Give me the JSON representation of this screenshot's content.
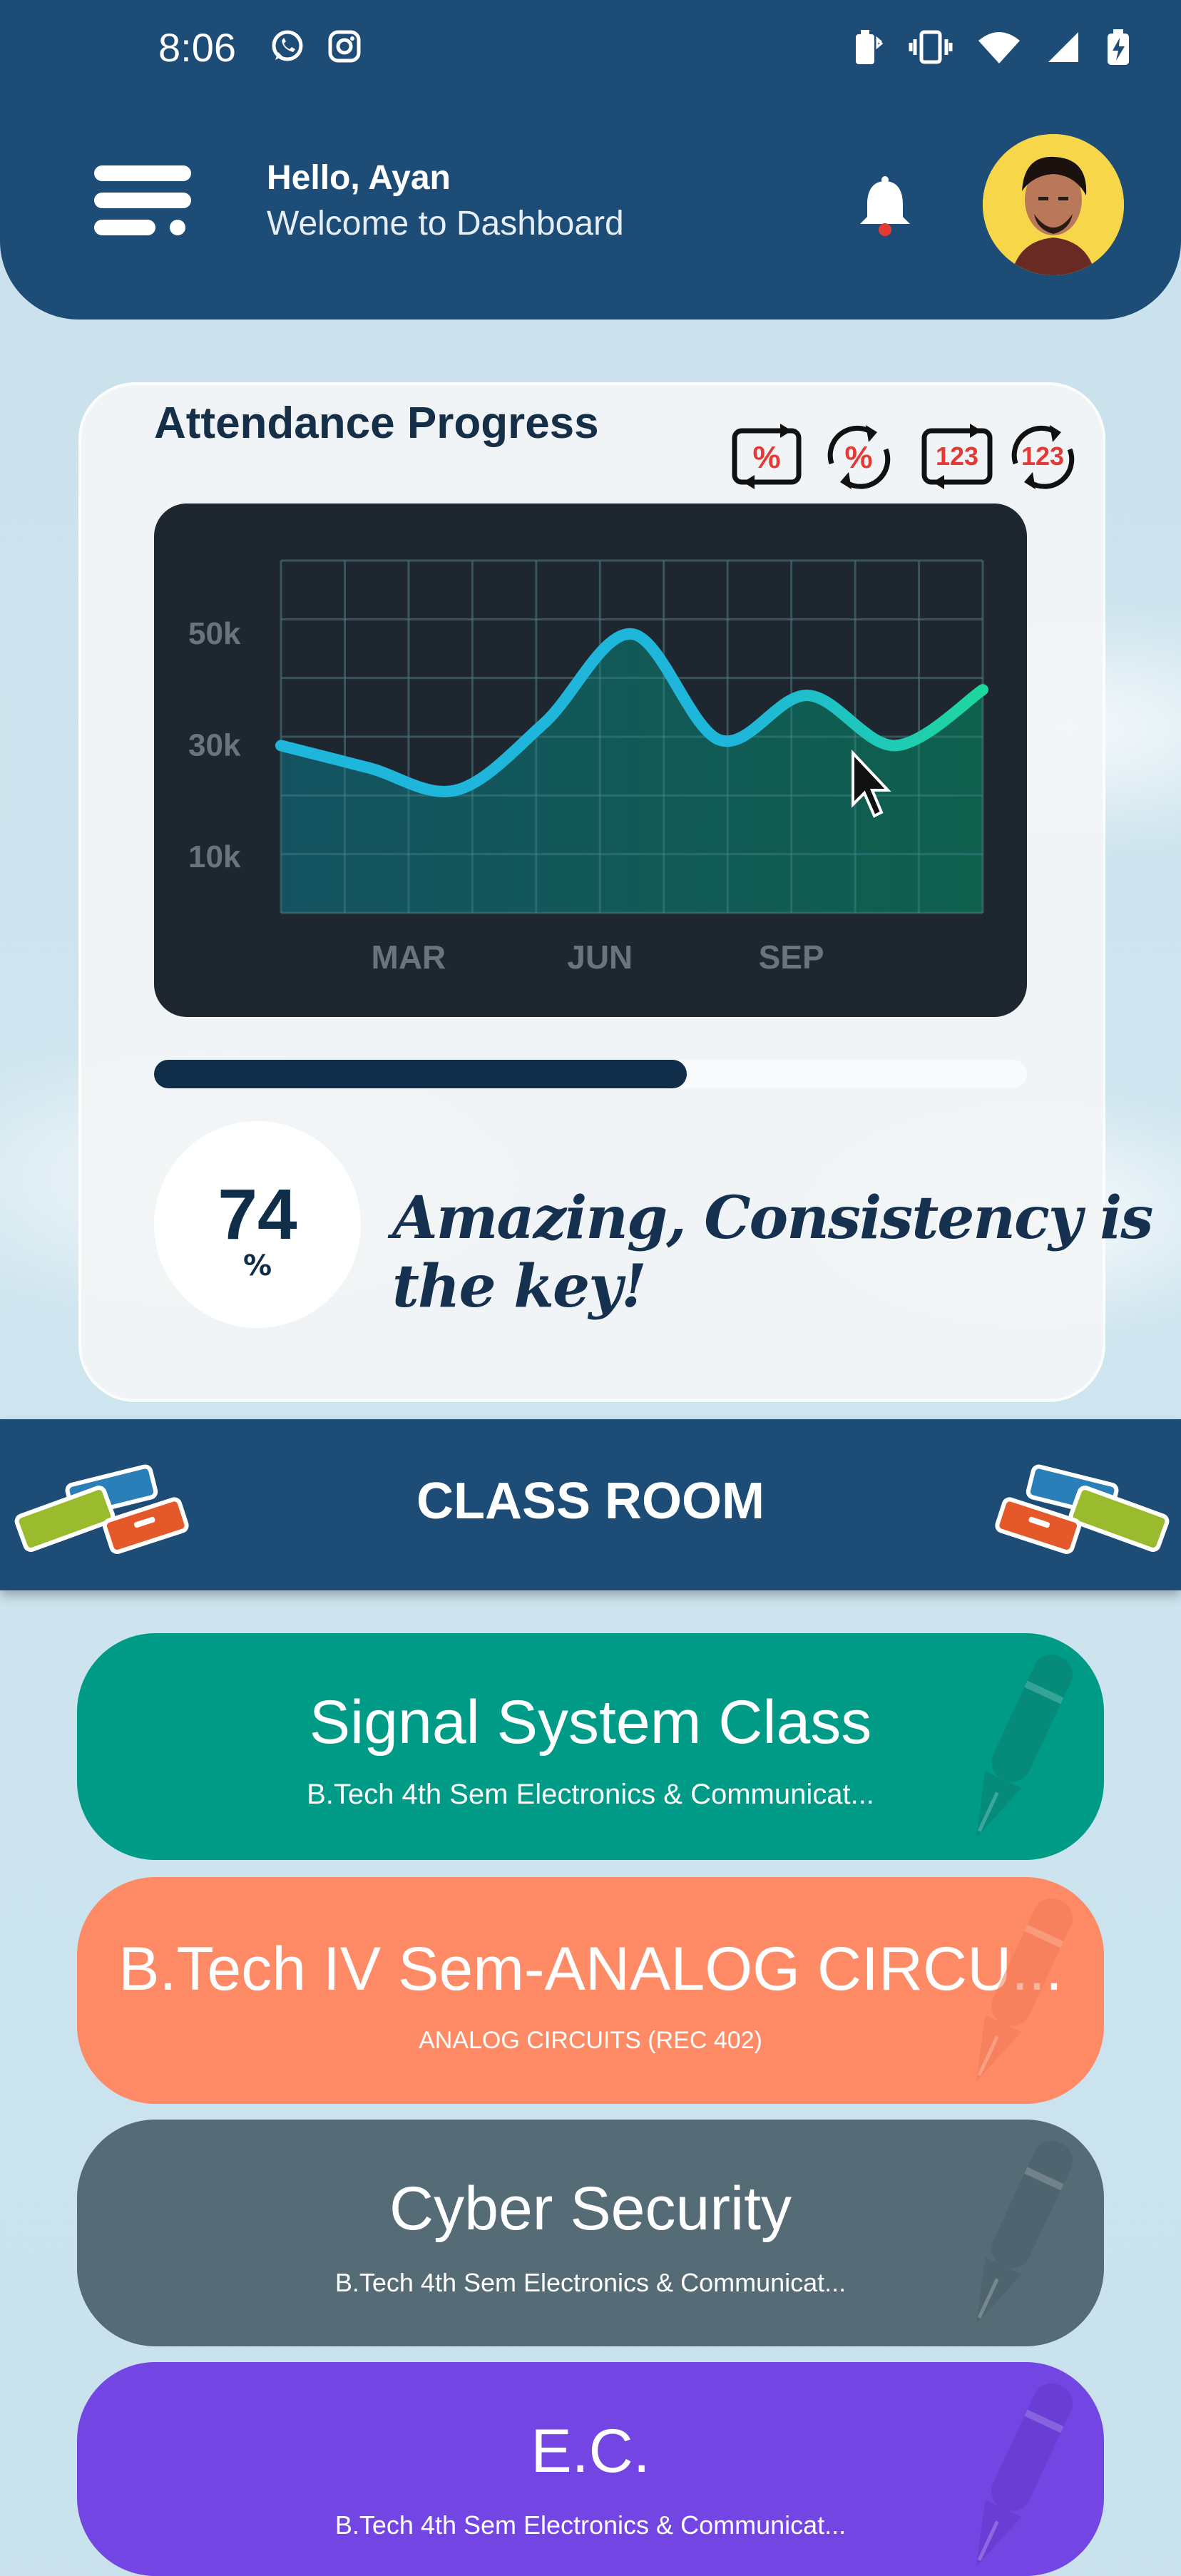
{
  "status_bar": {
    "time": "8:06"
  },
  "header": {
    "greeting": "Hello, Ayan",
    "subtitle": "Welcome to Dashboard"
  },
  "attendance": {
    "title": "Attendance Progress",
    "percent": "74",
    "percent_unit": "%",
    "progress_fraction": 0.61,
    "motto": "Amazing, Consistency is the key!",
    "format_buttons": [
      "%",
      "%",
      "123",
      "123"
    ]
  },
  "chart_data": {
    "type": "area",
    "x_ticks": [
      "MAR",
      "JUN",
      "SEP"
    ],
    "y_ticks": [
      "50k",
      "30k",
      "10k"
    ],
    "ylim": [
      0,
      60000
    ],
    "points": [
      30000,
      26000,
      22000,
      34000,
      50000,
      31000,
      39000,
      30000,
      40000
    ],
    "grid": true
  },
  "classroom": {
    "title": "CLASS ROOM",
    "classes": [
      {
        "title": "Signal System Class",
        "subtitle": "B.Tech 4th Sem Electronics & Communicat...",
        "color": "#009b87"
      },
      {
        "title": "B.Tech IV Sem-ANALOG CIRCU...",
        "subtitle": "ANALOG CIRCUITS (REC 402)",
        "color": "#ff8a66"
      },
      {
        "title": "Cyber Security",
        "subtitle": "B.Tech 4th Sem Electronics & Communicat...",
        "color": "#556b76"
      },
      {
        "title": "E.C.",
        "subtitle": "B.Tech 4th Sem Electronics & Communicat...",
        "color": "#7345e3"
      }
    ]
  },
  "colors": {
    "header": "#1d4c77",
    "chart_bg": "#1e272f",
    "line_start": "#1fb6dc",
    "line_end": "#1ed79e",
    "accent_red": "#e53935"
  }
}
